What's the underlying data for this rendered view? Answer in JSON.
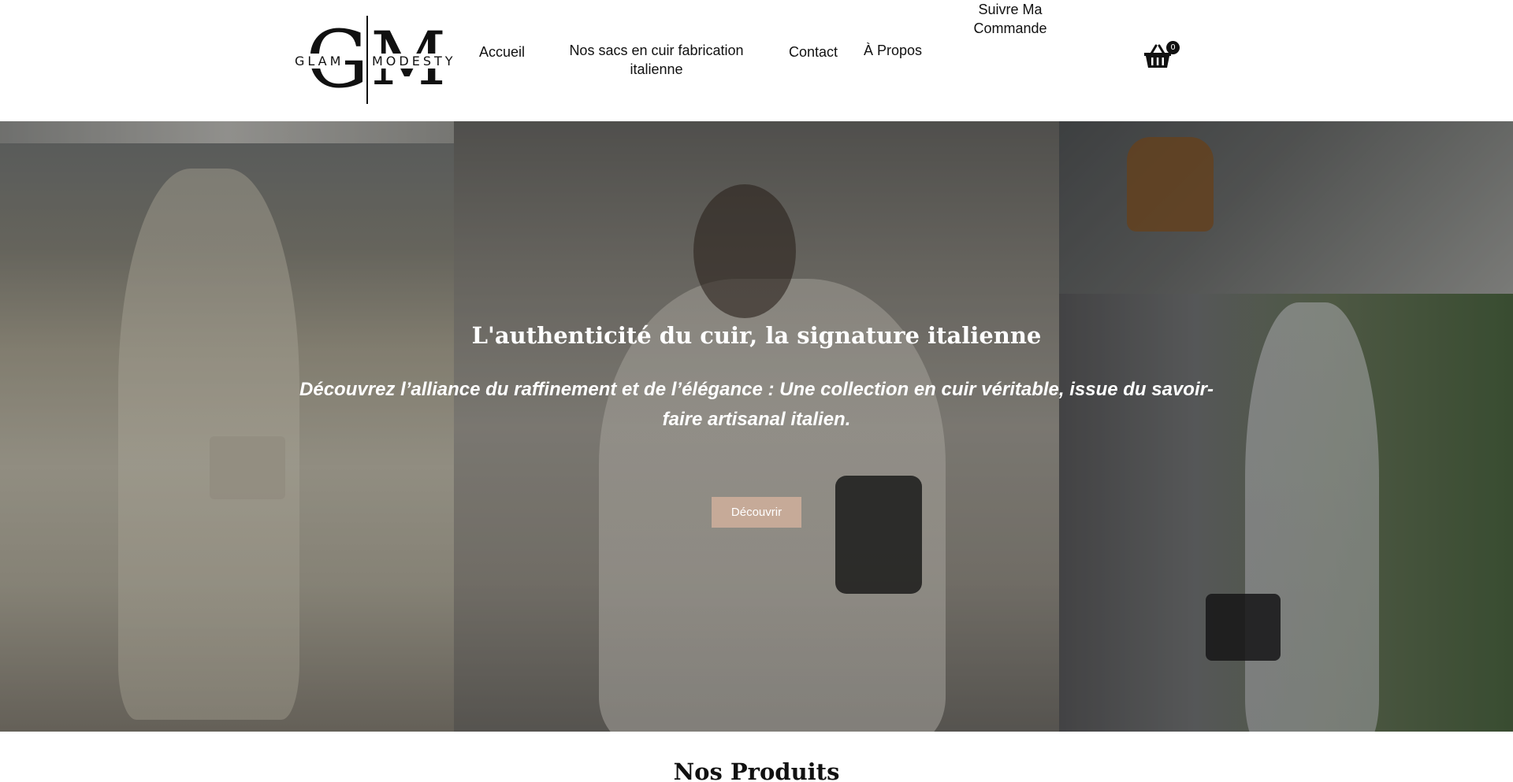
{
  "brand": {
    "monogram_left": "G",
    "monogram_right": "M",
    "word_left": "GLAM",
    "word_right": "MODESTY"
  },
  "nav": {
    "items": [
      {
        "label": "Accueil"
      },
      {
        "label": "Nos sacs en cuir fabrication italienne"
      },
      {
        "label": "Contact"
      },
      {
        "label": "À Propos"
      },
      {
        "label": "Suivre Ma Commande"
      }
    ]
  },
  "cart": {
    "count": "0",
    "icon": "basket-icon"
  },
  "hero": {
    "title": "L'authenticité du cuir, la signature italienne",
    "subtitle": "Découvrez l’alliance du raffinement et de l’élégance  : Une collection en cuir véritable, issue du savoir-faire artisanal italien.",
    "button_label": "Découvrir",
    "button_color": "#c6aa98"
  },
  "products": {
    "title": "Nos Produits"
  }
}
